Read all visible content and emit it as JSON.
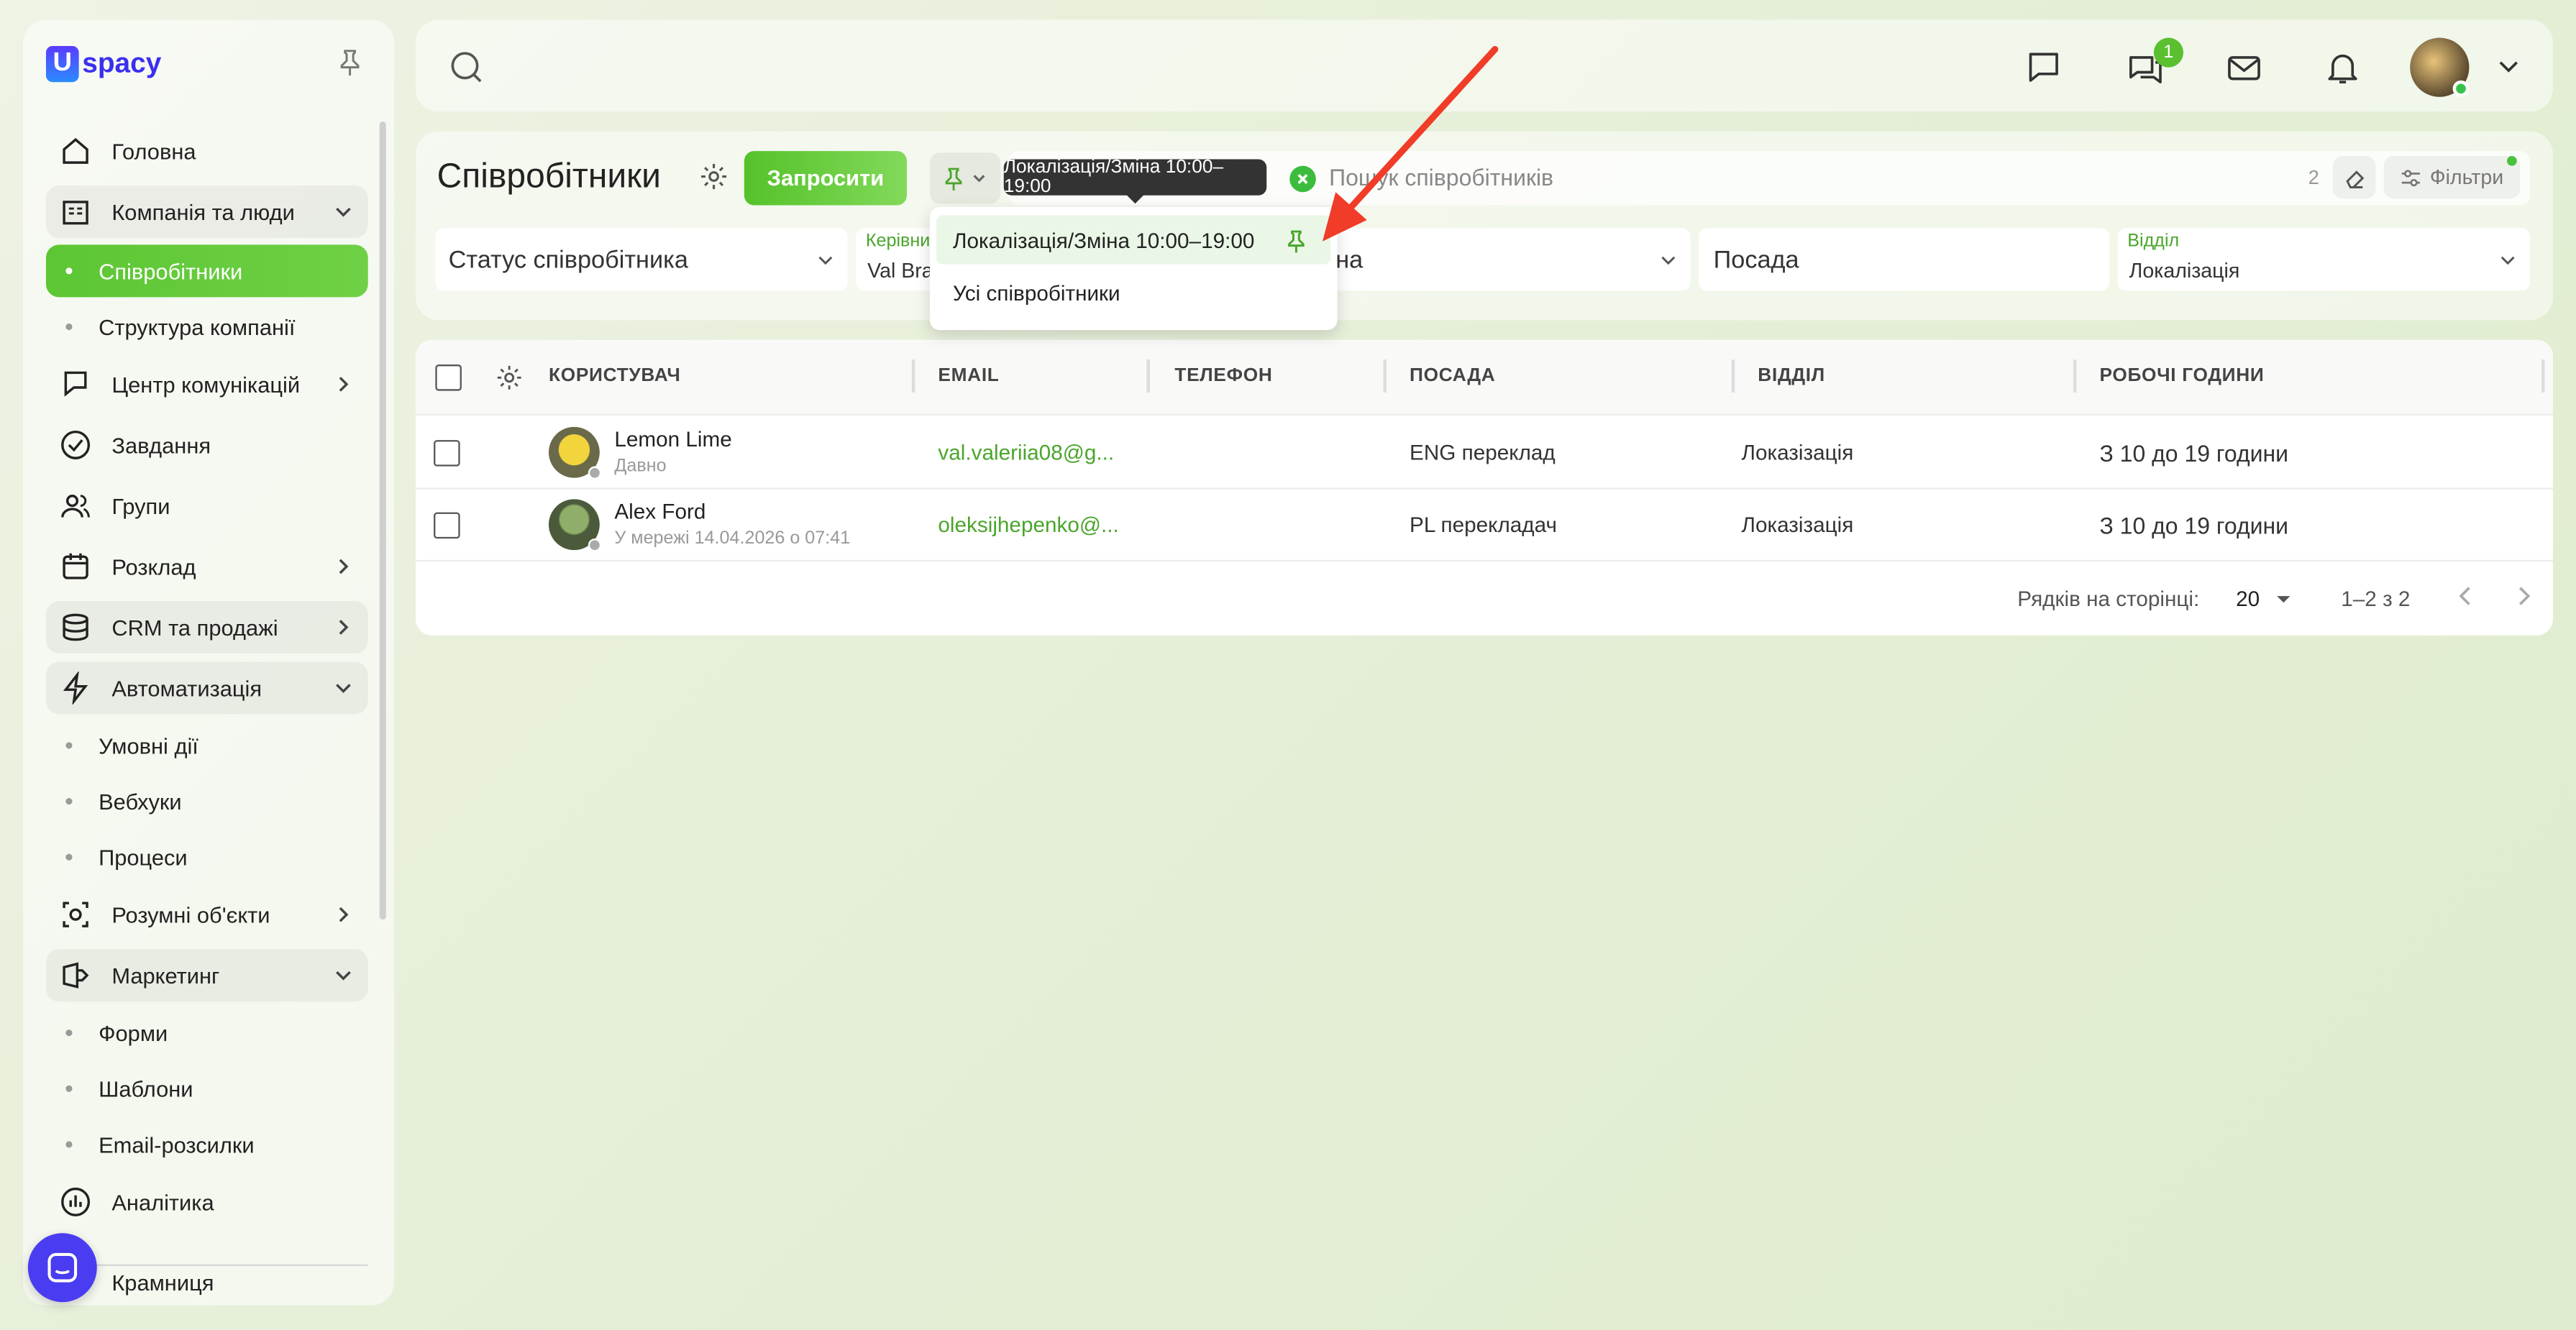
{
  "app": {
    "logo_text": "spacy",
    "logo_letter": "U"
  },
  "sidebar": {
    "items": [
      {
        "label": "Головна",
        "icon": "home-icon"
      },
      {
        "label": "Компанія та люди",
        "icon": "building-icon",
        "expanded": true
      },
      {
        "label": "Співробітники",
        "sub": true,
        "active": true
      },
      {
        "label": "Структура компанії",
        "sub": true
      },
      {
        "label": "Центр комунікацій",
        "icon": "communication-icon"
      },
      {
        "label": "Завдання",
        "icon": "task-check-icon"
      },
      {
        "label": "Групи",
        "icon": "groups-icon"
      },
      {
        "label": "Розклад",
        "icon": "calendar-icon"
      },
      {
        "label": "CRM та продажі",
        "icon": "database-icon"
      },
      {
        "label": "Автоматизація",
        "icon": "lightning-icon",
        "expanded": true
      },
      {
        "label": "Умовні дії",
        "sub": true
      },
      {
        "label": "Вебхуки",
        "sub": true
      },
      {
        "label": "Процеси",
        "sub": true
      },
      {
        "label": "Розумні об'єкти",
        "icon": "smart-object-icon"
      },
      {
        "label": "Маркетинг",
        "icon": "marketing-icon",
        "expanded": true
      },
      {
        "label": "Форми",
        "sub": true
      },
      {
        "label": "Шаблони",
        "sub": true
      },
      {
        "label": "Email-розсилки",
        "sub": true
      },
      {
        "label": "Аналітика",
        "icon": "analytics-icon"
      },
      {
        "label": "Крамниця",
        "icon": "store-icon"
      }
    ]
  },
  "topbar": {
    "chat_badge": "1"
  },
  "page": {
    "title": "Співробітники",
    "invite_label": "Запросити",
    "search_placeholder": "Пошук співробітників",
    "search_count": "2",
    "filters_label": "Фільтри"
  },
  "filters": {
    "status": "Статус співробітника",
    "manager_label": "Керівни",
    "manager_value": "Val Bra",
    "shift_partial": "на",
    "position": "Посада",
    "department_label": "Відділ",
    "department_value": "Локалізація"
  },
  "tooltip": "Локалізація/Зміна 10:00–19:00",
  "dropdown": {
    "items": [
      "Локалізація/Зміна 10:00–19:00",
      "Усі співробітники"
    ]
  },
  "table": {
    "columns": [
      "КОРИСТУВАЧ",
      "EMAIL",
      "ТЕЛЕФОН",
      "ПОСАДА",
      "ВІДДІЛ",
      "РОБОЧІ ГОДИНИ"
    ],
    "rows": [
      {
        "name": "Lemon Lime",
        "status": "Давно",
        "email": "val.valeriia08@g...",
        "phone": "",
        "position": "ENG переклад",
        "department": "Локазізація",
        "hours": "З 10 до 19 години"
      },
      {
        "name": "Alex Ford",
        "status": "У мережі 14.04.2026 о 07:41",
        "email": "oleksijhepenko@...",
        "phone": "",
        "position": "PL перекладач",
        "department": "Локазізація",
        "hours": "З 10 до 19 години"
      }
    ]
  },
  "pagination": {
    "rows_label": "Рядків на сторінці:",
    "rows_value": "20",
    "range": "1–2 з 2"
  },
  "colors": {
    "accent": "#5ac02f",
    "arrow": "#f03c28"
  }
}
